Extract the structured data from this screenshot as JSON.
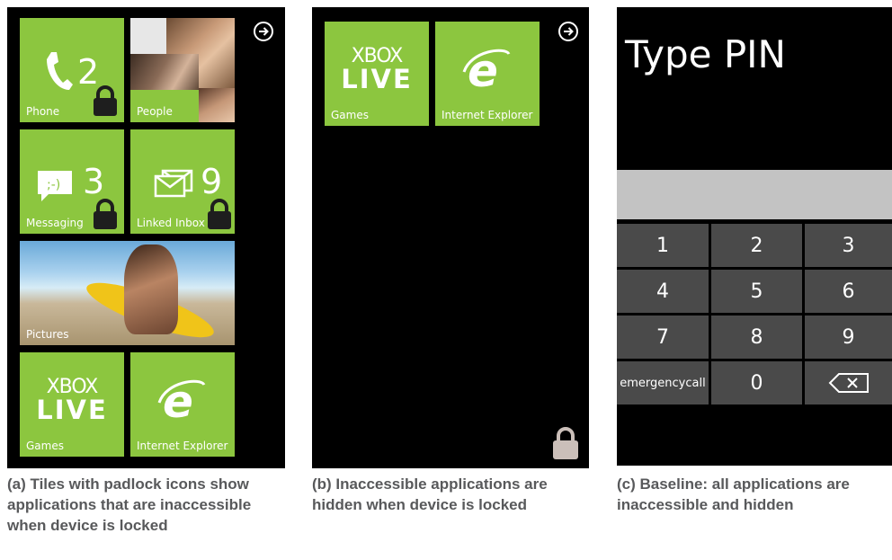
{
  "panel_a": {
    "tiles": {
      "phone": {
        "label": "Phone",
        "count": "2"
      },
      "people": {
        "label": "People"
      },
      "messaging": {
        "label": "Messaging",
        "count": "3"
      },
      "linked_inbox": {
        "label": "Linked Inbox",
        "count": "9"
      },
      "pictures": {
        "label": "Pictures"
      },
      "games": {
        "label": "Games",
        "logo_top": "XBOX",
        "logo_bottom": "LIVE"
      },
      "internet_explorer": {
        "label": "Internet Explorer"
      }
    },
    "caption": "(a) Tiles with padlock icons show applications that are inaccessible when device is locked"
  },
  "panel_b": {
    "tiles": {
      "games": {
        "label": "Games",
        "logo_top": "XBOX",
        "logo_bottom": "LIVE"
      },
      "internet_explorer": {
        "label": "Internet Explorer"
      }
    },
    "caption": "(b) Inaccessible  applications are hidden when device is locked"
  },
  "panel_c": {
    "title": "Type PIN",
    "keys": [
      "1",
      "2",
      "3",
      "4",
      "5",
      "6",
      "7",
      "8",
      "9",
      "emergencycall",
      "0"
    ],
    "caption": "(c) Baseline: all applications are  inaccessible and hidden"
  },
  "colors": {
    "tile": "#8cc63f",
    "key": "#4a4a4a",
    "field": "#c3c3c3",
    "caption": "#58595b"
  }
}
